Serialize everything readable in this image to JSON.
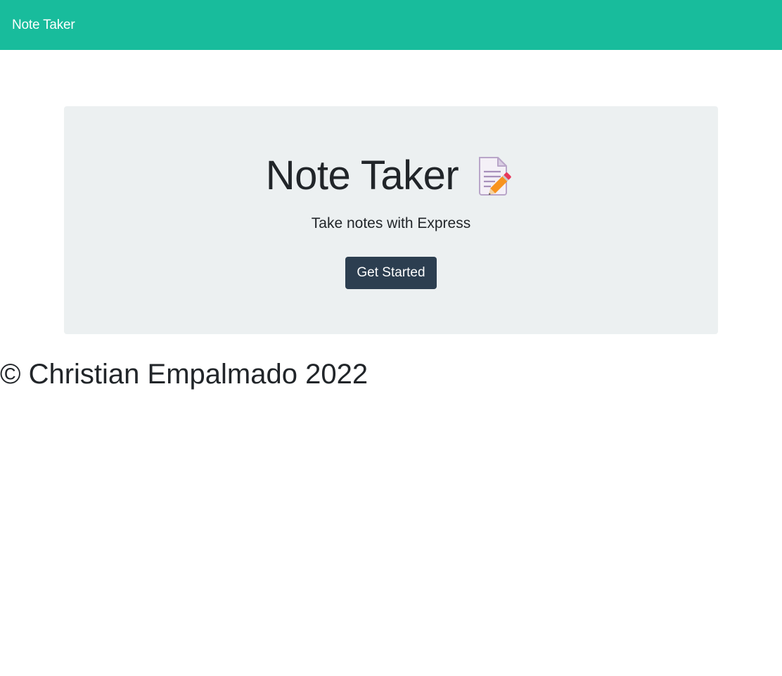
{
  "navbar": {
    "brand": "Note Taker",
    "background_color": "#18bc9c"
  },
  "hero": {
    "title": "Note Taker",
    "icon": "memo-icon",
    "subtitle": "Take notes with Express",
    "cta_label": "Get Started",
    "background_color": "#ecf0f1",
    "cta_color": "#2c3e50"
  },
  "footer": {
    "text": "© Christian Empalmado 2022"
  }
}
